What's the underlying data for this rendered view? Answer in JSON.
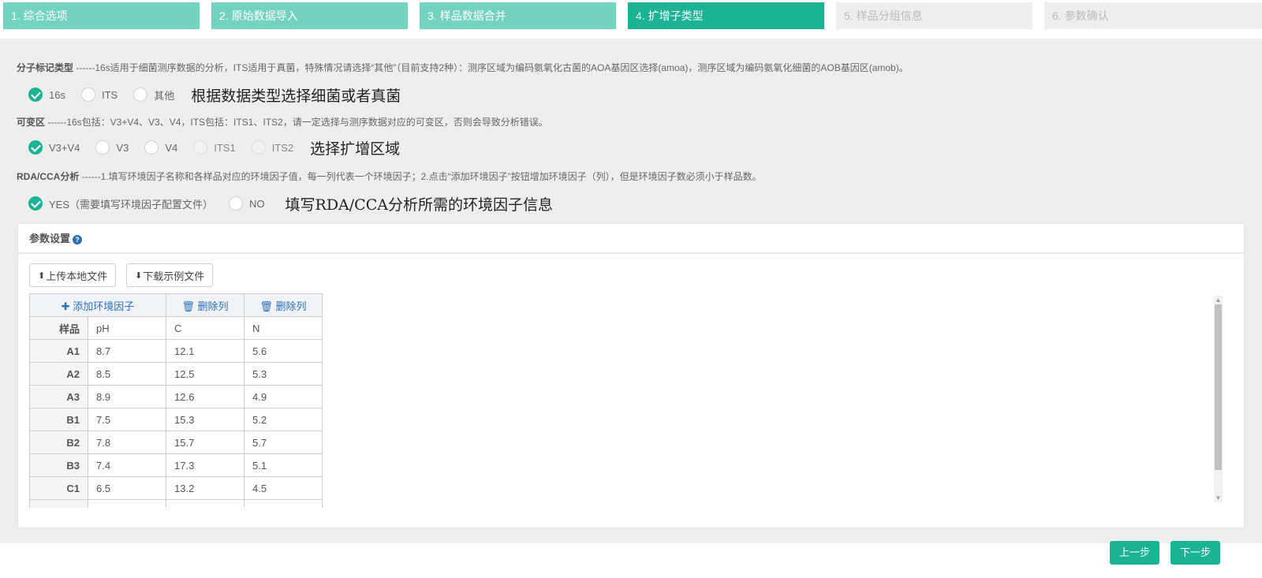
{
  "steps": [
    {
      "label": "1. 综合选项",
      "state": "done"
    },
    {
      "label": "2. 原始数据导入",
      "state": "done"
    },
    {
      "label": "3. 样品数据合并",
      "state": "done"
    },
    {
      "label": "4. 扩增子类型",
      "state": "active"
    },
    {
      "label": "5. 样品分组信息",
      "state": "todo"
    },
    {
      "label": "6. 参数确认",
      "state": "todo"
    }
  ],
  "marker": {
    "title": "分子标记类型",
    "desc": " ------16s适用于细菌测序数据的分析，ITS适用于真菌，特殊情况请选择“其他”（目前支持2种）：测序区域为编码氨氧化古菌的AOA基因区选择(amoa)，测序区域为编码氨氧化细菌的AOB基因区(amob)。",
    "options": [
      "16s",
      "ITS",
      "其他"
    ],
    "selected": "16s",
    "hint": "根据数据类型选择细菌或者真菌"
  },
  "region": {
    "title": "可变区",
    "desc": " ------16s包括：V3+V4、V3、V4，ITS包括：ITS1、ITS2，请一定选择与测序数据对应的可变区，否则会导致分析错误。",
    "options": [
      "V3+V4",
      "V3",
      "V4",
      "ITS1",
      "ITS2"
    ],
    "selected": "V3+V4",
    "hint": "选择扩增区域"
  },
  "rda": {
    "title": "RDA/CCA分析",
    "desc": " ------1.填写环境因子名称和各样品对应的环境因子值，每一列代表一个环境因子；2.点击“添加环境因子”按钮增加环境因子（列），但是环境因子数必须小于样品数。",
    "options": [
      "YES（需要填写环境因子配置文件）",
      "NO"
    ],
    "selected": "YES（需要填写环境因子配置文件）",
    "hint": "填写RDA/CCA分析所需的环境因子信息"
  },
  "params": {
    "title": "参数设置",
    "upload_label": "上传本地文件",
    "download_label": "下载示例文件",
    "add_factor_label": "添加环境因子",
    "delete_col_label": "删除列",
    "sample_header": "样品",
    "columns": [
      "pH",
      "C",
      "N"
    ],
    "rows": [
      {
        "sample": "A1",
        "values": [
          "8.7",
          "12.1",
          "5.6"
        ]
      },
      {
        "sample": "A2",
        "values": [
          "8.5",
          "12.5",
          "5.3"
        ]
      },
      {
        "sample": "A3",
        "values": [
          "8.9",
          "12.6",
          "4.9"
        ]
      },
      {
        "sample": "B1",
        "values": [
          "7.5",
          "15.3",
          "5.2"
        ]
      },
      {
        "sample": "B2",
        "values": [
          "7.8",
          "15.7",
          "5.7"
        ]
      },
      {
        "sample": "B3",
        "values": [
          "7.4",
          "17.3",
          "5.1"
        ]
      },
      {
        "sample": "C1",
        "values": [
          "6.5",
          "13.2",
          "4.5"
        ]
      },
      {
        "sample": "",
        "values": [
          "",
          "",
          ""
        ]
      }
    ]
  },
  "nav": {
    "prev_label": "上一步",
    "next_label": "下一步"
  },
  "colors": {
    "accent": "#1bb394",
    "done": "#74d3bf",
    "link": "#2c6fbd"
  }
}
